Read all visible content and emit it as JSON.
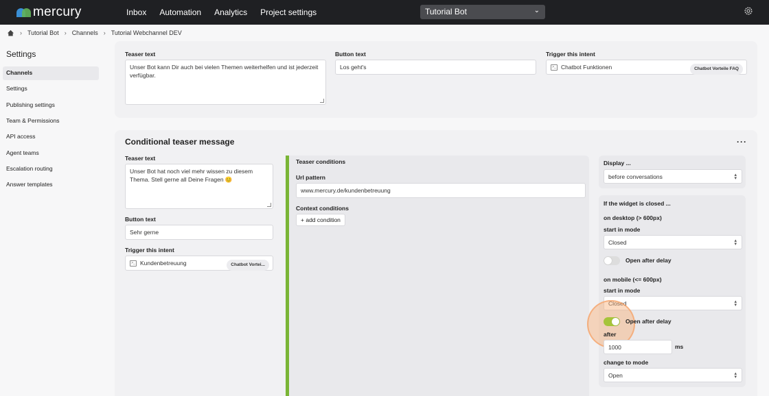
{
  "app": {
    "logo_text": "mercury",
    "nav": [
      "Inbox",
      "Automation",
      "Analytics",
      "Project settings"
    ],
    "bot_select": "Tutorial Bot"
  },
  "breadcrumb": [
    "Tutorial Bot",
    "Channels",
    "Tutorial Webchannel DEV"
  ],
  "sidebar": {
    "title": "Settings",
    "items": [
      "Channels",
      "Settings",
      "Publishing settings",
      "Team & Permissions",
      "API access",
      "Agent teams",
      "Escalation routing",
      "Answer templates"
    ]
  },
  "teaser_card": {
    "teaser_text_label": "Teaser text",
    "teaser_text_value": "Unser Bot kann Dir auch bei vielen Themen weiterhelfen und ist jederzeit verfügbar.",
    "button_text_label": "Button text",
    "button_text_value": "Los geht's",
    "trigger_label": "Trigger this intent",
    "trigger_value": "Chatbot Funktionen",
    "trigger_tag": "Chatbot Vorteile FAQ"
  },
  "conditional": {
    "title": "Conditional teaser message",
    "more": "···",
    "teaser_text_label": "Teaser text",
    "teaser_text_value": "Unser Bot hat noch viel mehr wissen zu diesem Thema. Stell gerne all Deine Fragen 😊",
    "button_text_label": "Button text",
    "button_text_value": "Sehr gerne",
    "trigger_label": "Trigger this intent",
    "trigger_value": "Kundenbetreuung",
    "trigger_tag": "Chatbot Vortei...",
    "conditions": {
      "title": "Teaser conditions",
      "url_label": "Url pattern",
      "url_value": "www.mercury.de/kundenbetreuung",
      "context_label": "Context conditions",
      "add_button": "add condition"
    },
    "display": {
      "label": "Display ...",
      "value": "before conversations"
    },
    "closed": {
      "title": "If the widget is closed ...",
      "desktop_label": "on desktop (> 600px)",
      "desktop_start_label": "start in mode",
      "desktop_start_value": "Closed",
      "desktop_toggle_label": "Open after delay",
      "desktop_toggle_on": false,
      "mobile_label": "on mobile (<= 600px)",
      "mobile_start_label": "start in mode",
      "mobile_start_value": "Closed",
      "mobile_toggle_label": "Open after delay",
      "mobile_toggle_on": true,
      "after_label": "after",
      "after_value": "1000",
      "after_unit": "ms",
      "change_label": "change to mode",
      "change_value": "Open"
    }
  },
  "colors": {
    "topbar": "#1f2023",
    "accent_green": "#7ab536",
    "toggle_on": "#a6c43a",
    "highlight": "#f8b078"
  }
}
